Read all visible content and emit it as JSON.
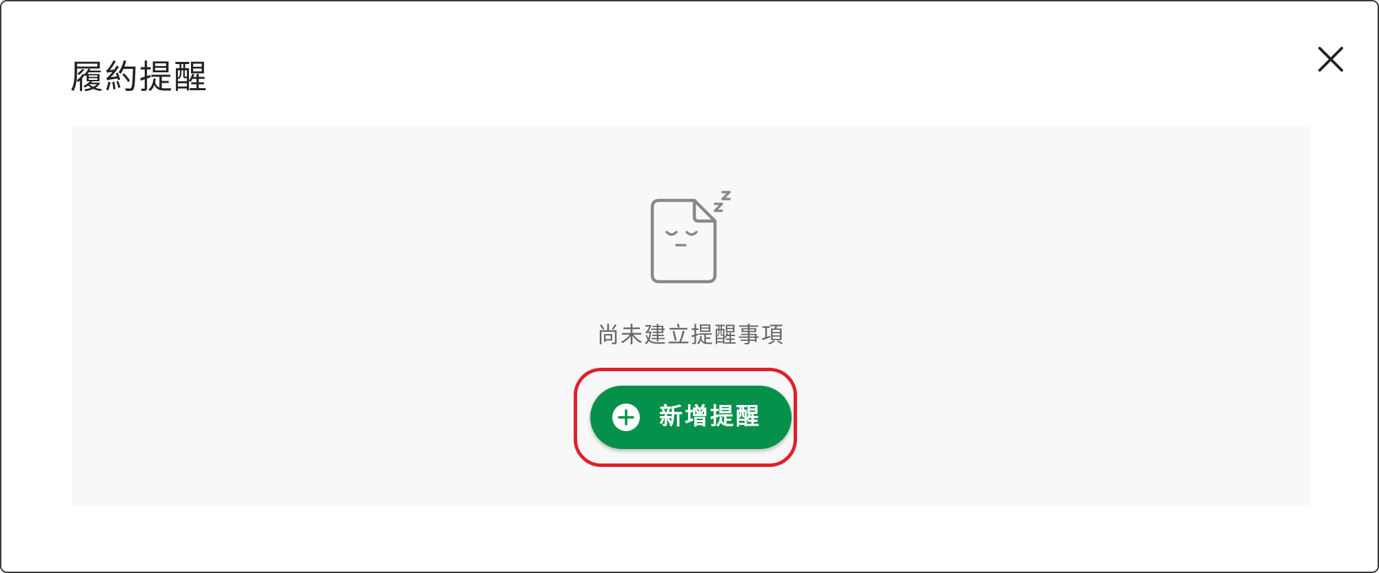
{
  "modal": {
    "title": "履約提醒",
    "close_icon": "close-icon"
  },
  "empty_state": {
    "illustration_icon": "sleeping-document-icon",
    "message": "尚未建立提醒事項",
    "add_button": {
      "icon": "plus-circle-icon",
      "label": "新增提醒"
    }
  },
  "colors": {
    "primary_green": "#06914a",
    "highlight_red": "#e0202c",
    "panel_background": "#f8f8f8",
    "icon_gray": "#888888"
  }
}
